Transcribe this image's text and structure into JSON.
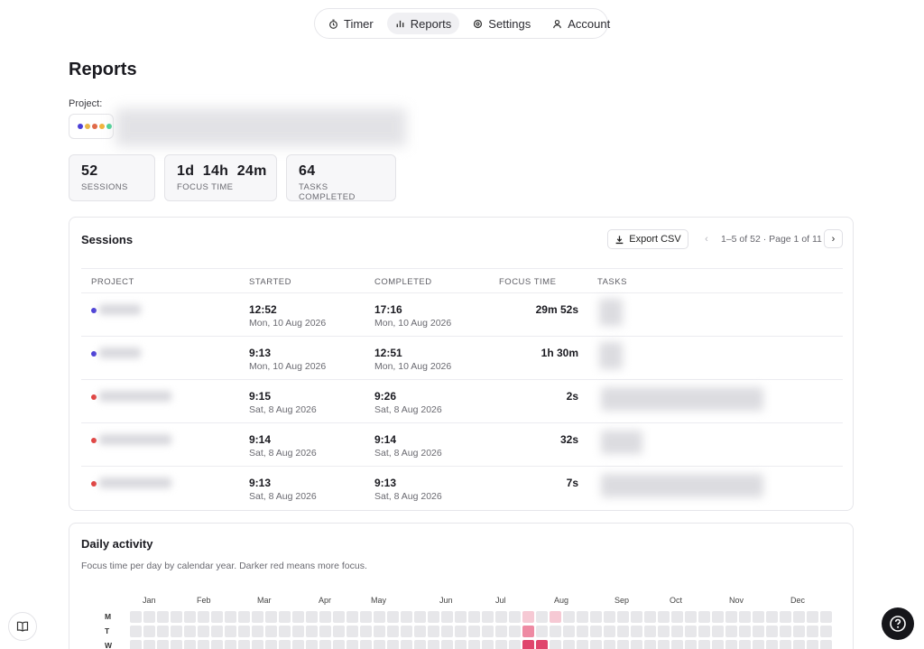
{
  "nav": {
    "items": [
      {
        "label": "Timer",
        "icon": "timer-icon",
        "active": false
      },
      {
        "label": "Reports",
        "icon": "bar-chart-icon",
        "active": true
      },
      {
        "label": "Settings",
        "icon": "gear-icon",
        "active": false
      },
      {
        "label": "Account",
        "icon": "user-icon",
        "active": false
      }
    ]
  },
  "page": {
    "title": "Reports"
  },
  "project": {
    "label": "Project:",
    "dot_colors": [
      "#4b3fd6",
      "#e8b64a",
      "#e06a4a",
      "#f0b33c",
      "#3fcf8e"
    ]
  },
  "stats": [
    {
      "value": "52",
      "label": "SESSIONS"
    },
    {
      "value": "1d  14h  24m",
      "label": "FOCUS TIME"
    },
    {
      "value": "64",
      "label": "TASKS COMPLETED"
    }
  ],
  "sessions": {
    "title": "Sessions",
    "export_label": "Export CSV",
    "pager_text": "1–5 of 52 · Page 1 of 11",
    "columns": [
      "PROJECT",
      "STARTED",
      "COMPLETED",
      "FOCUS TIME",
      "TASKS"
    ],
    "rows": [
      {
        "dot": "#4b3fd6",
        "start_time": "12:52",
        "start_date": "Mon, 10 Aug 2026",
        "end_time": "17:16",
        "end_date": "Mon, 10 Aug 2026",
        "focus": "29m 52s"
      },
      {
        "dot": "#4b3fd6",
        "start_time": "9:13",
        "start_date": "Mon, 10 Aug 2026",
        "end_time": "12:51",
        "end_date": "Mon, 10 Aug 2026",
        "focus": "1h 30m"
      },
      {
        "dot": "#e0413f",
        "start_time": "9:15",
        "start_date": "Sat, 8 Aug 2026",
        "end_time": "9:26",
        "end_date": "Sat, 8 Aug 2026",
        "focus": "2s"
      },
      {
        "dot": "#e0413f",
        "start_time": "9:14",
        "start_date": "Sat, 8 Aug 2026",
        "end_time": "9:14",
        "end_date": "Sat, 8 Aug 2026",
        "focus": "32s"
      },
      {
        "dot": "#e0413f",
        "start_time": "9:13",
        "start_date": "Sat, 8 Aug 2026",
        "end_time": "9:13",
        "end_date": "Sat, 8 Aug 2026",
        "focus": "7s"
      }
    ]
  },
  "daily": {
    "title": "Daily activity",
    "subtitle": "Focus time per day by calendar year. Darker red means more focus.",
    "months": [
      "Jan",
      "Feb",
      "Mar",
      "Apr",
      "May",
      "Jun",
      "Jul",
      "Aug",
      "Sep",
      "Oct",
      "Nov",
      "Dec"
    ],
    "day_labels": [
      "M",
      "T",
      "W"
    ],
    "colors": {
      "empty": "#e7e7ea",
      "light": "#f6c9d4",
      "mid": "#ee8aa3",
      "dark": "#e0456c"
    }
  }
}
